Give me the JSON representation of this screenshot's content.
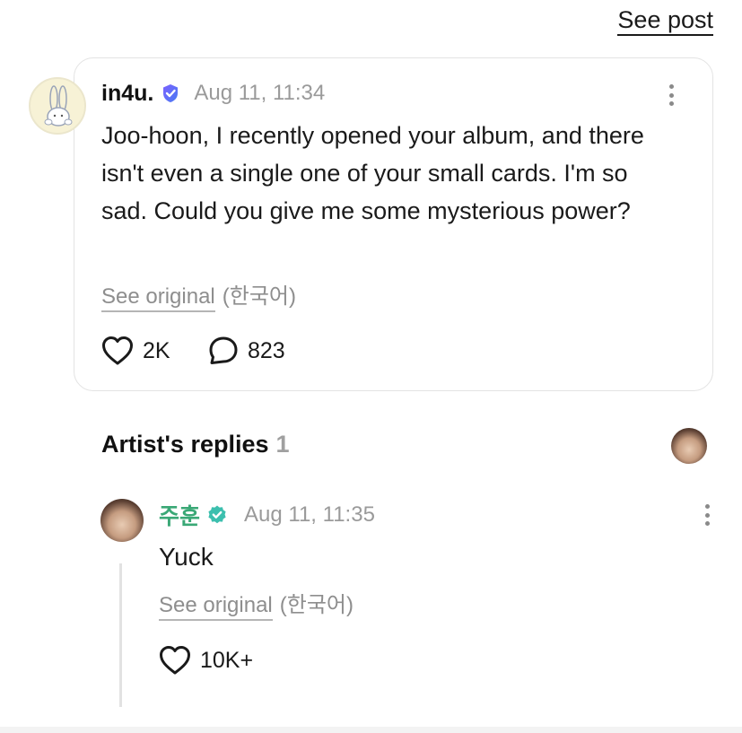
{
  "header": {
    "see_post_label": "See post"
  },
  "post": {
    "username": "in4u.",
    "timestamp": "Aug 11, 11:34",
    "body": "Joo-hoon, I recently opened your album, and there isn't even a single one of your small cards. I'm so sad. Could you give me some mysterious power?",
    "see_original_label": "See original",
    "language": "(한국어)",
    "likes": "2K",
    "comments": "823"
  },
  "artist_replies": {
    "title": "Artist's replies",
    "count": "1"
  },
  "reply": {
    "username": "주훈",
    "timestamp": "Aug 11, 11:35",
    "body": "Yuck",
    "see_original_label": "See original",
    "language": "(한국어)",
    "likes": "10K+"
  },
  "colors": {
    "artist_name": "#3aa876",
    "verified_badge_post": "#6b5cf0",
    "verified_badge_artist": "#3cbfae",
    "muted_text": "#9a9a9a"
  }
}
